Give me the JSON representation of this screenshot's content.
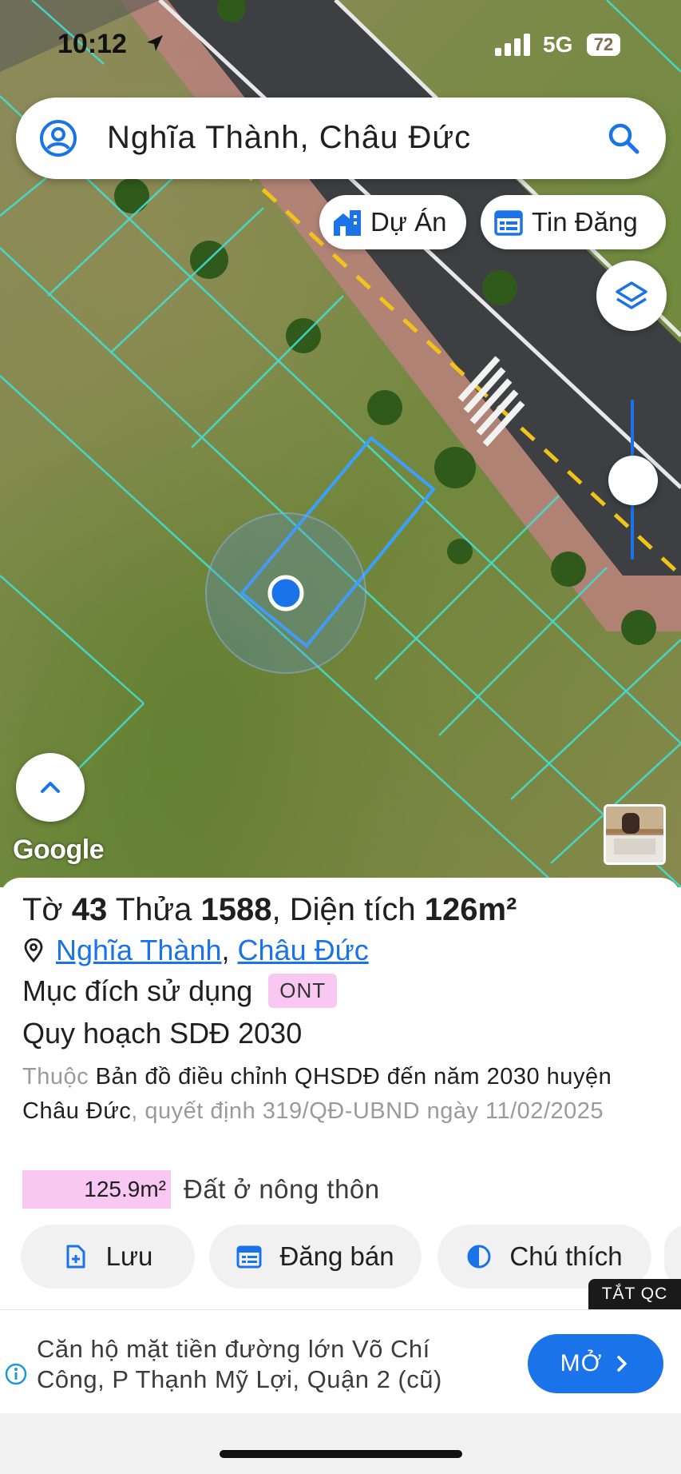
{
  "status_bar": {
    "time": "10:12",
    "network": "5G",
    "battery": "72"
  },
  "search": {
    "query": "Nghĩa Thành, Châu Đức"
  },
  "chips": {
    "du_an": "Dự Án",
    "tin_dang": "Tin Đăng"
  },
  "map": {
    "attribution": "Google"
  },
  "parcel": {
    "title_prefix_1": "Tờ",
    "sheet_no": "43",
    "title_prefix_2": "Thửa",
    "parcel_no": "1588",
    "area_label": ", Diện tích",
    "area_value": "126m²",
    "ward": "Nghĩa Thành",
    "separator": ",",
    "district": "Châu Đức",
    "purpose_label": "Mục đích sử dụng",
    "purpose_code": "ONT",
    "plan_title": "Quy hoạch SDĐ 2030",
    "plan_desc_prefix": "Thuộc",
    "plan_desc_main": "Bản đồ điều chỉnh QHSDĐ đến năm 2030 huyện Châu Đức",
    "plan_desc_suffix": ", quyết định 319/QĐ-UBND ngày 11/02/2025",
    "land_area": "125.9m²",
    "land_type": "Đất ở nông thôn"
  },
  "actions": {
    "save": "Lưu",
    "post": "Đăng bán",
    "legend": "Chú thích"
  },
  "ad": {
    "close_label": "TẮT QC",
    "text": "Căn hộ mặt tiền đường lớn Võ Chí Công, P Thạnh Mỹ Lợi, Quận 2 (cũ)",
    "open_label": "MỞ"
  },
  "colors": {
    "accent": "#1a73e8",
    "badge": "#f8c7f2",
    "parcel_line": "#3aa0ff",
    "grid_line": "#40e0d0"
  }
}
